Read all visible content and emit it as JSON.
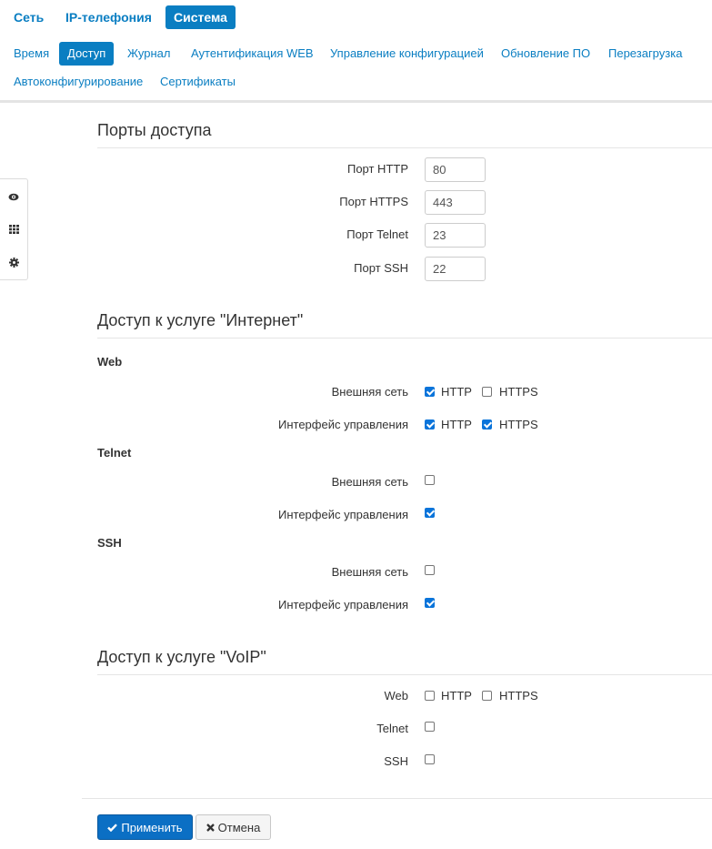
{
  "main_tabs": [
    {
      "label": "Сеть",
      "active": false
    },
    {
      "label": "IP-телефония",
      "active": false
    },
    {
      "label": "Система",
      "active": true
    }
  ],
  "sub_tabs": [
    {
      "label": "Время",
      "active": false
    },
    {
      "label": "Доступ",
      "active": true
    },
    {
      "label": "Журнал",
      "active": false
    },
    {
      "label": "Аутентификация WEB",
      "active": false
    },
    {
      "label": "Управление конфигурацией",
      "active": false
    },
    {
      "label": "Обновление ПО",
      "active": false
    },
    {
      "label": "Перезагрузка",
      "active": false
    },
    {
      "label": "Автоконфигурирование",
      "active": false
    },
    {
      "label": "Сертификаты",
      "active": false
    }
  ],
  "side_tools": [
    "eye-icon",
    "grid-icon",
    "gear-icon"
  ],
  "ports": {
    "title": "Порты доступа",
    "http_label": "Порт HTTP",
    "http_value": "80",
    "https_label": "Порт HTTPS",
    "https_value": "443",
    "telnet_label": "Порт Telnet",
    "telnet_value": "23",
    "ssh_label": "Порт SSH",
    "ssh_value": "22"
  },
  "internet": {
    "title": "Доступ к услуге \"Интернет\"",
    "web": {
      "title": "Web",
      "external_label": "Внешняя сеть",
      "external_http": true,
      "external_https": false,
      "mgmt_label": "Интерфейс управления",
      "mgmt_http": true,
      "mgmt_https": true
    },
    "telnet": {
      "title": "Telnet",
      "external_label": "Внешняя сеть",
      "external": false,
      "mgmt_label": "Интерфейс управления",
      "mgmt": true
    },
    "ssh": {
      "title": "SSH",
      "external_label": "Внешняя сеть",
      "external": false,
      "mgmt_label": "Интерфейс управления",
      "mgmt": true
    }
  },
  "voip": {
    "title": "Доступ к услуге \"VoIP\"",
    "web_label": "Web",
    "web_http": false,
    "web_https": false,
    "telnet_label": "Telnet",
    "telnet": false,
    "ssh_label": "SSH",
    "ssh": false
  },
  "protocols": {
    "http": "HTTP",
    "https": "HTTPS"
  },
  "buttons": {
    "apply": "Применить",
    "cancel": "Отмена"
  },
  "colors": {
    "accent": "#0a7ec2",
    "primary_button": "#0b6fc4",
    "checkbox_checked": "#0a74da"
  }
}
